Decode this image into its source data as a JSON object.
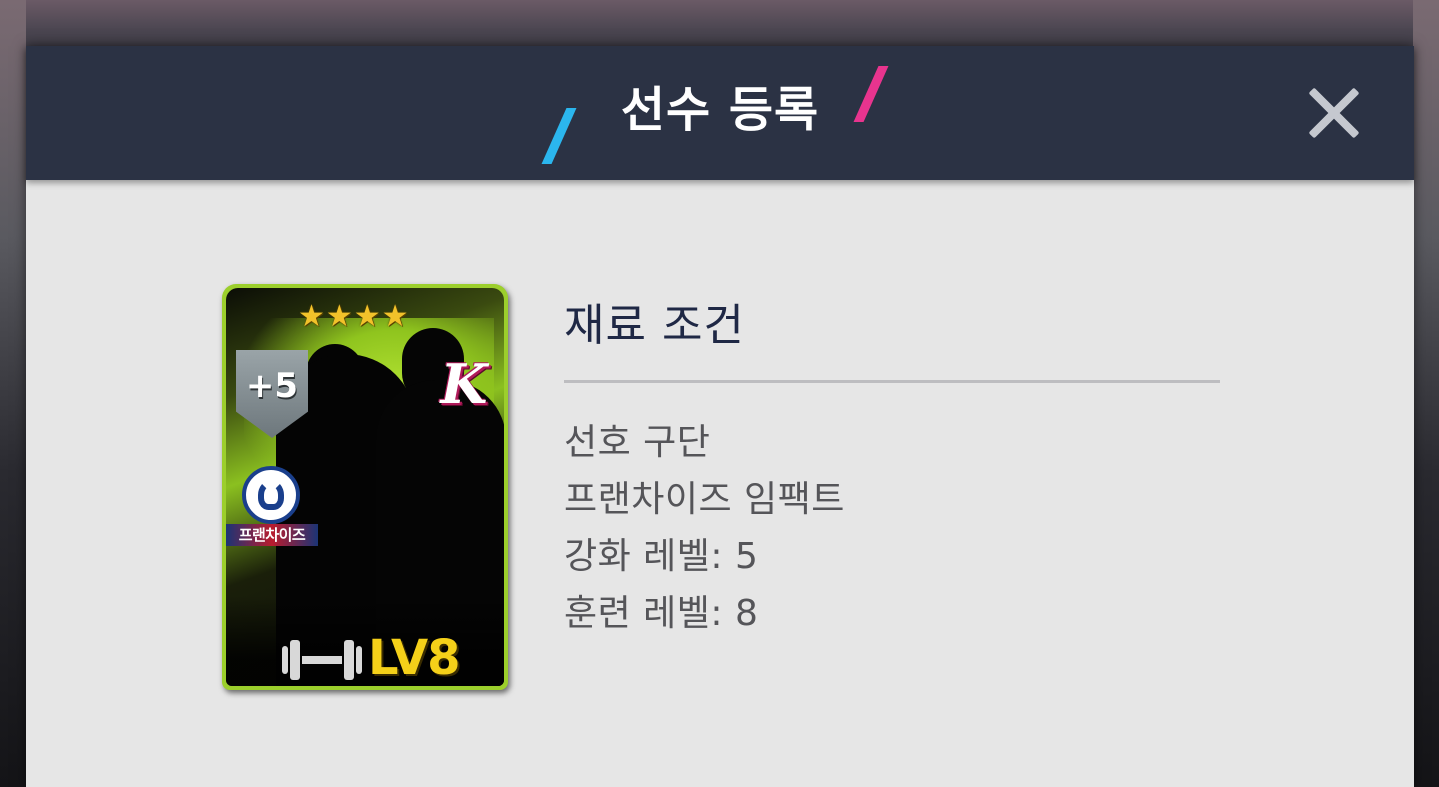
{
  "dialog": {
    "title": "선수 등록",
    "close_icon": "close-icon"
  },
  "card": {
    "stars": "★★★★",
    "star_count": 4,
    "enhance_badge": "+5",
    "team_letter": "K",
    "franchise_label": "프랜차이즈",
    "training_level": "LV8",
    "icons": [
      "star-icon",
      "shield-badge-icon",
      "team-logo-icon",
      "dumbbell-icon"
    ],
    "colors": {
      "frame": "#9ccf2c",
      "level": "#f5d019",
      "stars": "#f2c22a"
    }
  },
  "requirements": {
    "title": "재료 조건",
    "items": [
      "선호 구단",
      "프랜차이즈 임팩트",
      "강화 레벨: 5",
      "훈련 레벨: 8"
    ]
  },
  "colors": {
    "header": "#2b3244",
    "panel": "#e6e6e6",
    "accent_blue": "#2bb6ee",
    "accent_pink": "#e8348e"
  }
}
